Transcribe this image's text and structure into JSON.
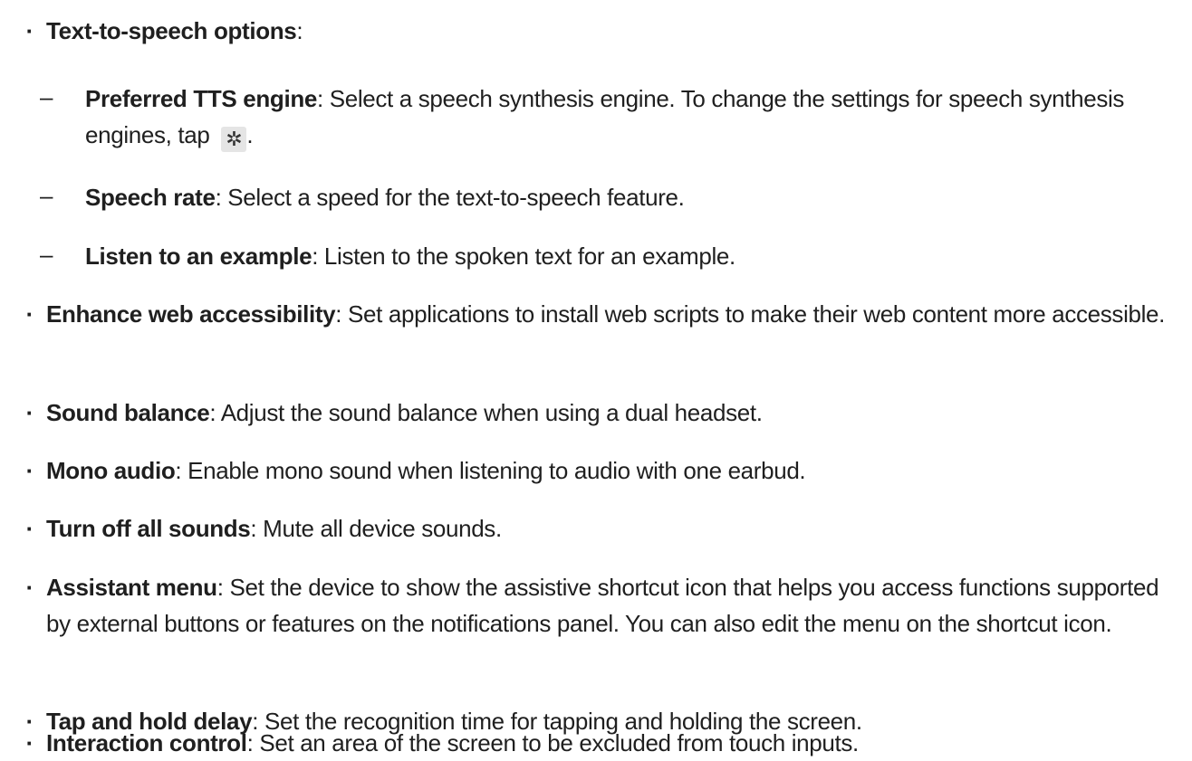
{
  "items": [
    {
      "level": 1,
      "term": "Text-to-speech options",
      "desc": ""
    },
    {
      "level": 2,
      "term": "Preferred TTS engine",
      "desc": ": Select a speech synthesis engine. To change the settings for speech synthesis engines, tap ",
      "icon": "gear-icon",
      "tail": "."
    },
    {
      "level": 2,
      "term": "Speech rate",
      "desc": ": Select a speed for the text-to-speech feature."
    },
    {
      "level": 2,
      "term": "Listen to an example",
      "desc": ": Listen to the spoken text for an example."
    },
    {
      "level": 1,
      "term": "Enhance web accessibility",
      "desc": ": Set applications to install web scripts to make their web content more accessible."
    },
    {
      "level": 1,
      "term": "Sound balance",
      "desc": ": Adjust the sound balance when using a dual headset."
    },
    {
      "level": 1,
      "term": "Mono audio",
      "desc": ": Enable mono sound when listening to audio with one earbud."
    },
    {
      "level": 1,
      "term": "Turn off all sounds",
      "desc": ": Mute all device sounds."
    },
    {
      "level": 1,
      "term": "Assistant menu",
      "desc": ": Set the device to show the assistive shortcut icon that helps you access functions supported by external buttons or features on the notifications panel. You can also edit the menu on the shortcut icon."
    },
    {
      "level": 1,
      "term": "Tap and hold delay",
      "desc": ": Set the recognition time for tapping and holding the screen."
    },
    {
      "level": 1,
      "term": "Interaction control",
      "desc": ": Set an area of the screen to be excluded from touch inputs."
    }
  ],
  "first_item_suffix": ":",
  "bullet_glyph": "·",
  "dash_glyph": "–",
  "gear_glyph": "✲"
}
